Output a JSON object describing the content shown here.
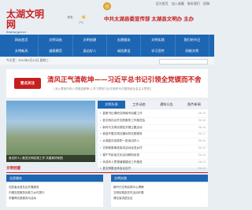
{
  "top_links": [
    "设为首页",
    "加入收藏",
    "联系我们",
    "投稿"
  ],
  "logo": {
    "title": "太湖文明网",
    "subtitle": "thwmw.gov.cn"
  },
  "weather": {
    "city": "安庆",
    "desc": "7°C"
  },
  "header_title": "中共太湖县委宣传部  太湖县文明办  主办",
  "nav": [
    "网站首页",
    "文明动态",
    "文明创建",
    "志愿服务",
    "文明实践",
    "我们的节日",
    "文明新风",
    "道德模范",
    "身边好人",
    "诚信建设",
    "学习宣传",
    "网络文明"
  ],
  "breadcrumb": "今天是：2024年6月19日 星期三",
  "headline": {
    "badge": "要点关注",
    "title": "清风正气清乾坤——习近平总书记引领全党锲而不舍",
    "sub": "[ 深入贯彻中央八项规定精神 ]  [ 学习贯彻习近平新时代中国特色社会主义思想 ]"
  },
  "photo_caption": "身边好人 | 推进文明实践工作 共建美好家园",
  "tabs": [
    "文明头条",
    "工作动态",
    "通知公告",
    "图片新闻"
  ],
  "news": [
    {
      "title": "县委书记调研文明城市创建工作",
      "date": "06-19"
    },
    {
      "title": "县文明办召开志愿服务工作推进会",
      "date": "06-18"
    },
    {
      "title": "新时代文明实践站开展主题活动",
      "date": "06-18"
    },
    {
      "title": "我县开展文明交通劝导志愿服务",
      "date": "06-17"
    },
    {
      "title": "太湖县评选表彰一批身边好人",
      "date": "06-16"
    },
    {
      "title": "文明家庭事迹宣讲活动走进乡村",
      "date": "06-15"
    },
    {
      "title": "端午节民俗文化活动精彩纷呈",
      "date": "06-14"
    },
    {
      "title": "未成年人思想道德建设工作推进",
      "date": "06-13"
    },
    {
      "title": "县文明委全体会议召开",
      "date": "06-12"
    }
  ],
  "section_label": "文明创建",
  "lower_tabs": [
    "志愿服务",
    "文明实践"
  ],
  "lower_left": [
    "志愿者走进社区开展服务",
    "巾帼志愿服务队助力乡村振兴",
    "学雷锋志愿服务月活动"
  ],
  "lower_right": [
    "新时代文明实践中心揭牌",
    "文明实践进农村活动开展",
    "理论宣讲进社区"
  ]
}
